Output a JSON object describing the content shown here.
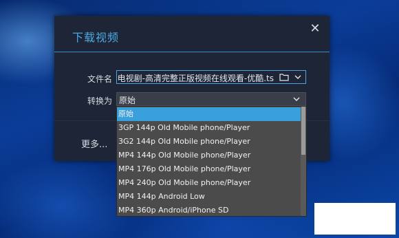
{
  "dialog": {
    "title": "下载视频",
    "close_icon": "close-icon",
    "filename_label": "文件名",
    "filename_value": "-电视剧-高清完整正版视频在线观看-优酷.ts",
    "convert_label": "转换为",
    "convert_value": "原始",
    "more_label": "更多..."
  },
  "dropdown": {
    "options": [
      "原始",
      "3GP 144p Old Mobile phone/Player",
      "3G2 144p Old Mobile phone/Player",
      "MP4 144p Old Mobile phone/Player",
      "MP4 176p Old Mobile phone/Player",
      "MP4 240p Old Mobile phone/Player",
      "MP4 144p Android Low",
      "MP4 360p Android/iPhone SD"
    ],
    "selected_index": 0
  },
  "colors": {
    "accent": "#4aa9e3",
    "dialog_bg": "#1e2536",
    "selected_option": "#3aa0dc",
    "dropdown_bg": "#4b4b4b"
  }
}
